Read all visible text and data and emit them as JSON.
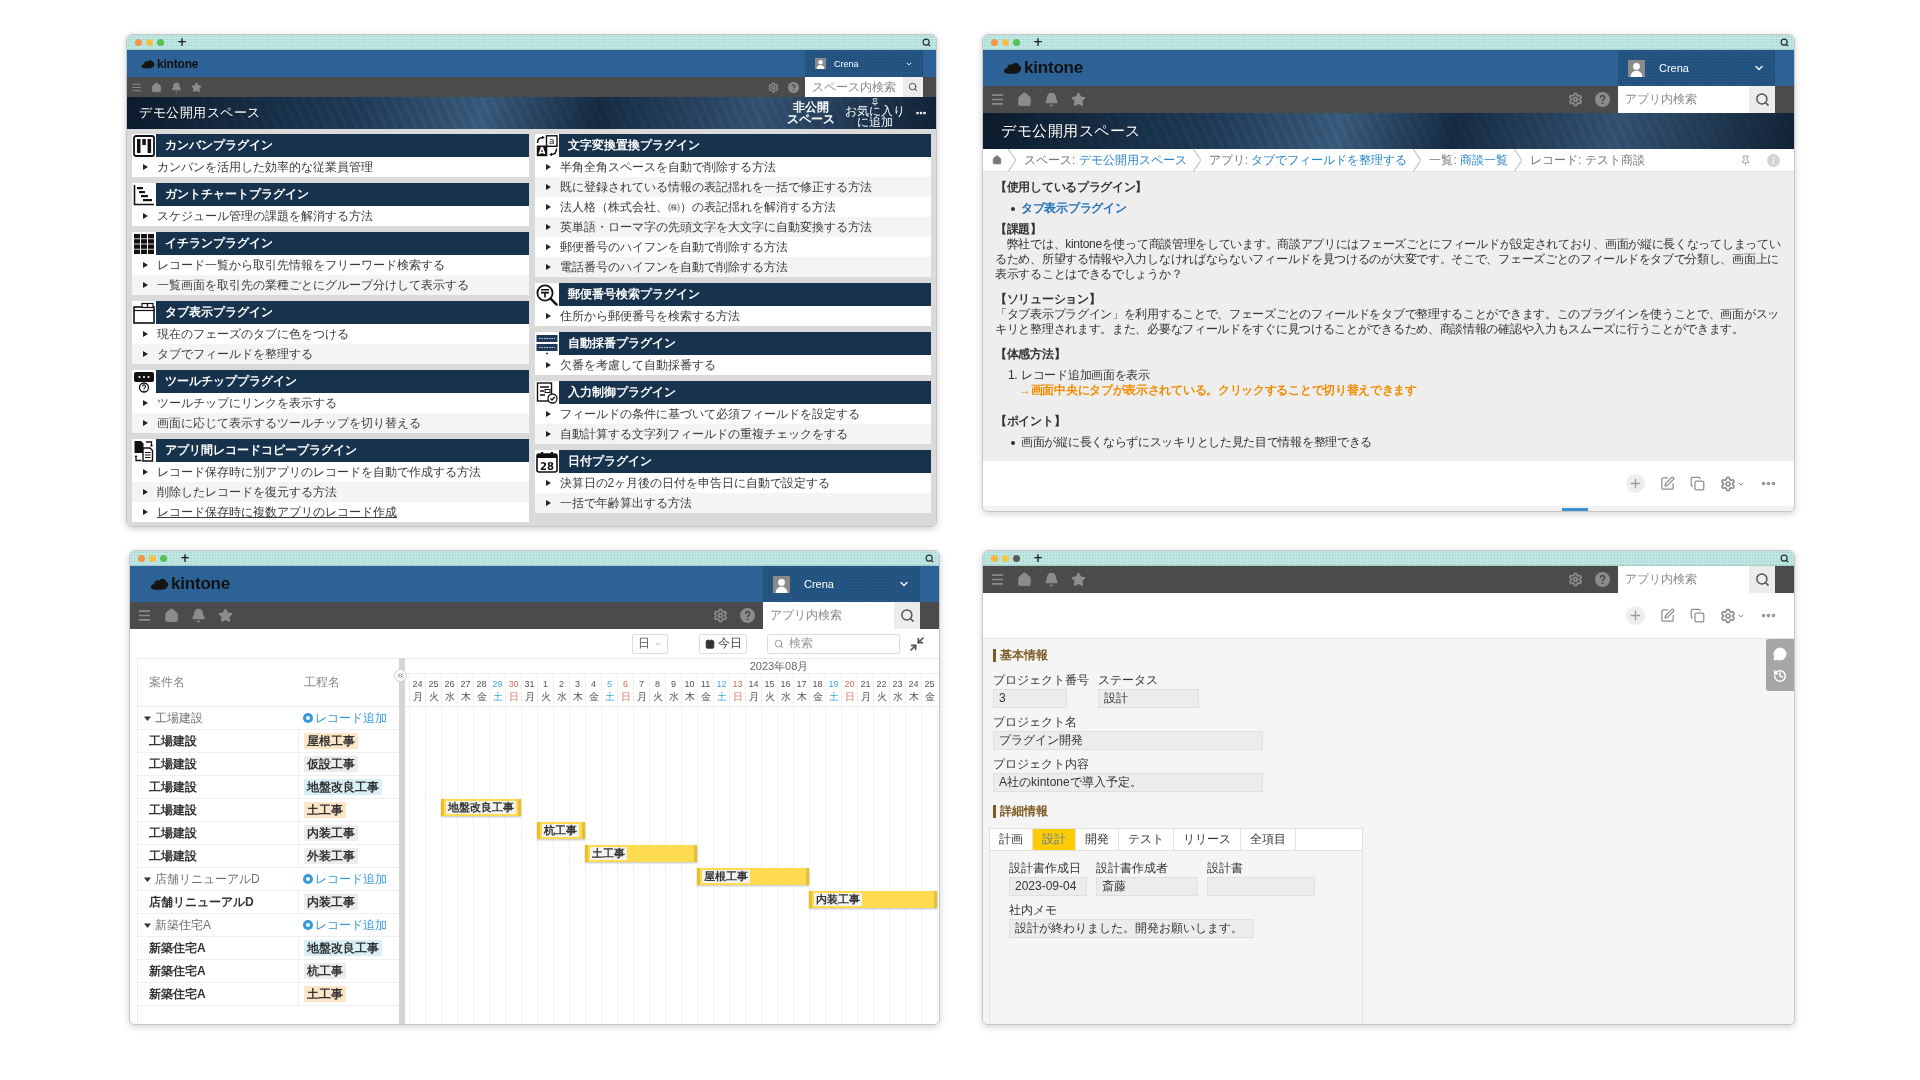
{
  "plugin_list_window": {
    "traffic_lights": [
      {
        "color": "#f0954a"
      },
      {
        "color": "#f5c04a"
      },
      {
        "color": "#56c14f"
      }
    ],
    "new_tab": "+",
    "logo": "kintone",
    "user": "Crena",
    "search": {
      "placeholder": "スペース内検索"
    },
    "banner": {
      "title": "デモ公開用スペース",
      "private_label": [
        "非公開",
        "スペース"
      ],
      "favorite_label": [
        "お気に入り",
        "に追加"
      ]
    },
    "columns": [
      {
        "sections": [
          {
            "title": "カンバンプラグイン",
            "kind": "kanban",
            "items": [
              {
                "text": "カンバンを活用した効率的な従業員管理",
                "underlined": false
              }
            ]
          },
          {
            "title": "ガントチャートプラグイン",
            "kind": "gantt",
            "items": [
              {
                "text": "スケジュール管理の課題を解消する方法",
                "underlined": false
              }
            ]
          },
          {
            "title": "イチランプラグイン",
            "kind": "grid",
            "items": [
              {
                "text": "レコード一覧から取引先情報をフリーワード検索する",
                "underlined": false
              },
              {
                "text": "一覧画面を取引先の業種ごとにグループ分けして表示する",
                "underlined": false
              }
            ]
          },
          {
            "title": "タブ表示プラグイン",
            "kind": "tab",
            "items": [
              {
                "text": "現在のフェーズのタブに色をつける",
                "underlined": false
              },
              {
                "text": "タブでフィールドを整理する",
                "underlined": false
              }
            ]
          },
          {
            "title": "ツールチッププラグイン",
            "kind": "tooltip",
            "items": [
              {
                "text": "ツールチップにリンクを表示する",
                "underlined": false
              },
              {
                "text": "画面に応じて表示するツールチップを切り替える",
                "underlined": false
              }
            ]
          },
          {
            "title": "アプリ間レコードコピープラグイン",
            "kind": "copy",
            "items": [
              {
                "text": "レコード保存時に別アプリのレコードを自動で作成する方法",
                "underlined": false
              },
              {
                "text": "削除したレコードを復元する方法",
                "underlined": false
              },
              {
                "text": "レコード保存時に複数アプリのレコード作成",
                "underlined": true
              }
            ]
          }
        ]
      },
      {
        "sections": [
          {
            "title": "文字変換置換プラグイン",
            "kind": "convert",
            "icon_text": [
              "a",
              "A"
            ],
            "items": [
              {
                "text": "半角全角スペースを自動で削除する方法",
                "underlined": false
              },
              {
                "text": "既に登録されている情報の表記揺れを一括で修正する方法",
                "underlined": false
              },
              {
                "text": "法人格（株式会社、㈱）の表記揺れを解消する方法",
                "underlined": false
              },
              {
                "text": "英単語・ローマ字の先頭文字を大文字に自動変換する方法",
                "underlined": false
              },
              {
                "text": "郵便番号のハイフンを自動で削除する方法",
                "underlined": false
              },
              {
                "text": "電話番号のハイフンを自動で削除する方法",
                "underlined": false
              }
            ]
          },
          {
            "title": "郵便番号検索プラグイン",
            "kind": "postal",
            "items": [
              {
                "text": "住所から郵便番号を検索する方法",
                "underlined": false
              }
            ]
          },
          {
            "title": "自動採番プラグイン",
            "kind": "numbering",
            "items": [
              {
                "text": "欠番を考慮して自動採番する",
                "underlined": false
              }
            ]
          },
          {
            "title": "入力制御プラグイン",
            "kind": "form",
            "items": [
              {
                "text": "フィールドの条件に基づいて必須フィールドを設定する",
                "underlined": false
              },
              {
                "text": "自動計算する文字列フィールドの重複チェックをする",
                "underlined": false
              }
            ]
          },
          {
            "title": "日付プラグイン",
            "kind": "calendar",
            "icon_text": [
              "28"
            ],
            "items": [
              {
                "text": "決算日の2ヶ月後の日付を申告日に自動で設定する",
                "underlined": false
              },
              {
                "text": "一括で年齢算出する方法",
                "underlined": false
              }
            ]
          }
        ]
      }
    ]
  },
  "record_detail_window": {
    "traffic_lights": [
      {
        "color": "#f0954a"
      },
      {
        "color": "#f5c04a"
      },
      {
        "color": "#56c14f"
      }
    ],
    "new_tab": "+",
    "logo": "kintone",
    "user": "Crena",
    "search": {
      "placeholder": "アプリ内検索"
    },
    "banner": {
      "title": "デモ公開用スペース"
    },
    "breadcrumbs": [
      {
        "label": "スペース:",
        "value": "デモ公開用スペース",
        "link": true
      },
      {
        "label": "アプリ:",
        "value": "タブでフィールドを整理する",
        "link": true
      },
      {
        "label": "一覧:",
        "value": "商談一覧",
        "link": true
      },
      {
        "label": "レコード:",
        "value": "テスト商談",
        "link": false
      }
    ],
    "content": [
      {
        "kind": "heading",
        "text": "【使用しているプラグイン】"
      },
      {
        "kind": "bullet",
        "text": "タブ表示プラグイン",
        "link": true
      },
      {
        "kind": "heading",
        "text": "【課題】"
      },
      {
        "kind": "paragraph",
        "text": "　弊社では、kintoneを使って商談管理をしています。商談アプリにはフェーズごとにフィールドが設定されており、画面が縦に長くなってしまっているため、所望する情報や入力しなければならないフィールドを見つけるのが大変です。そこで、フェーズごとのフィールドをタブで分類し、画面上に表示することはできるでしょうか？"
      },
      {
        "kind": "heading",
        "text": "【ソリューション】"
      },
      {
        "kind": "paragraph",
        "text": "「タブ表示プラグイン」を利用することで、フェーズごとのフィールドをタブで整理することができます。このプラグインを使うことで、画面がスッキリと整理されます。また、必要なフィールドをすぐに見つけることができるため、商談情報の確認や入力もスムーズに行うことができます。"
      },
      {
        "kind": "heading",
        "text": "【体感方法】"
      },
      {
        "kind": "numbered",
        "number": "1.",
        "text": "レコード追加画面を表示"
      },
      {
        "kind": "note",
        "text": "→画面中央にタブが表示されている。クリックすることで切り替えできます"
      },
      {
        "kind": "heading",
        "text": "【ポイント】"
      },
      {
        "kind": "bullet",
        "text": "画面が縦に長くならずにスッキリとした見た目で情報を整理できる",
        "link": false
      }
    ]
  },
  "gantt_window": {
    "traffic_lights": [
      {
        "color": "#f0954a"
      },
      {
        "color": "#f5c04a"
      },
      {
        "color": "#56c14f"
      }
    ],
    "new_tab": "+",
    "logo": "kintone",
    "user": "Crena",
    "search": {
      "placeholder": "アプリ内検索"
    },
    "toolbar": {
      "scale": "日",
      "today": "今日",
      "search_placeholder": "検索"
    },
    "list_columns": [
      "案件名",
      "工程名"
    ],
    "months": [
      {
        "days": [
          {
            "day": "24",
            "weekday": "月",
            "kind": "weekday"
          },
          {
            "day": "25",
            "weekday": "火",
            "kind": "weekday"
          },
          {
            "day": "26",
            "weekday": "水",
            "kind": "weekday"
          },
          {
            "day": "27",
            "weekday": "木",
            "kind": "weekday"
          },
          {
            "day": "28",
            "weekday": "金",
            "kind": "weekday"
          },
          {
            "day": "29",
            "weekday": "土",
            "kind": "saturday"
          },
          {
            "day": "30",
            "weekday": "日",
            "kind": "sunday"
          },
          {
            "day": "31",
            "weekday": "月",
            "kind": "weekday"
          }
        ]
      },
      {
        "label": "2023年08月",
        "days": [
          {
            "day": "1",
            "weekday": "火",
            "kind": "weekday"
          },
          {
            "day": "2",
            "weekday": "水",
            "kind": "weekday"
          },
          {
            "day": "3",
            "weekday": "木",
            "kind": "weekday"
          },
          {
            "day": "4",
            "weekday": "金",
            "kind": "weekday"
          },
          {
            "day": "5",
            "weekday": "土",
            "kind": "saturday"
          },
          {
            "day": "6",
            "weekday": "日",
            "kind": "sunday"
          },
          {
            "day": "7",
            "weekday": "月",
            "kind": "weekday"
          },
          {
            "day": "8",
            "weekday": "火",
            "kind": "weekday"
          },
          {
            "day": "9",
            "weekday": "水",
            "kind": "weekday"
          },
          {
            "day": "10",
            "weekday": "木",
            "kind": "weekday"
          },
          {
            "day": "11",
            "weekday": "金",
            "kind": "weekday"
          },
          {
            "day": "12",
            "weekday": "土",
            "kind": "saturday"
          },
          {
            "day": "13",
            "weekday": "日",
            "kind": "sunday"
          },
          {
            "day": "14",
            "weekday": "月",
            "kind": "weekday"
          },
          {
            "day": "15",
            "weekday": "火",
            "kind": "weekday"
          },
          {
            "day": "16",
            "weekday": "水",
            "kind": "weekday"
          },
          {
            "day": "17",
            "weekday": "木",
            "kind": "weekday"
          },
          {
            "day": "18",
            "weekday": "金",
            "kind": "weekday"
          },
          {
            "day": "19",
            "weekday": "土",
            "kind": "saturday"
          },
          {
            "day": "20",
            "weekday": "日",
            "kind": "sunday"
          },
          {
            "day": "21",
            "weekday": "月",
            "kind": "weekday"
          },
          {
            "day": "22",
            "weekday": "火",
            "kind": "weekday"
          },
          {
            "day": "23",
            "weekday": "水",
            "kind": "weekday"
          },
          {
            "day": "24",
            "weekday": "木",
            "kind": "weekday"
          },
          {
            "day": "25",
            "weekday": "金",
            "kind": "weekday"
          }
        ]
      }
    ],
    "groups": [
      {
        "name": "工場建設",
        "expanded": true,
        "add_label": "レコード追加",
        "rows": [
          {
            "name": "工場建設",
            "process": "屋根工事",
            "color": "#fbe6c8"
          },
          {
            "name": "工場建設",
            "process": "仮設工事",
            "color": "#ececec"
          },
          {
            "name": "工場建設",
            "process": "地盤改良工事",
            "color": "#d8eff6"
          },
          {
            "name": "工場建設",
            "process": "土工事",
            "color": "#fbe6c8",
            "bar": {
              "label": "地盤改良工事",
              "start": {
                "level": 0.0606
              },
              "end": {
                "level": 0.2121
              }
            }
          },
          {
            "name": "工場建設",
            "process": "内装工事",
            "color": "#ececec",
            "bar": {
              "label": "杭工事",
              "start": {
                "level": 0.2424
              },
              "end": {
                "level": 0.3333
              }
            }
          },
          {
            "name": "工場建設",
            "process": "外装工事",
            "color": "#ececec",
            "bar": {
              "label": "土工事",
              "start": {
                "level": 0.3333
              },
              "end": {
                "level": 0.5455
              }
            }
          }
        ]
      },
      {
        "name": "店舗リニューアルD",
        "expanded": true,
        "add_label": "レコード追加",
        "bar": {
          "label": "屋根工事",
          "start": {
            "level": 0.5455
          },
          "end": {
            "level": 0.7576
          }
        },
        "rows": [
          {
            "name": "店舗リニューアルD",
            "process": "内装工事",
            "color": "#ececec",
            "bar": {
              "label": "内装工事",
              "start": {
                "level": 0.7576
              },
              "end": {
                "level": 1
              }
            }
          }
        ]
      },
      {
        "name": "新築住宅A",
        "expanded": true,
        "add_label": "レコード追加",
        "rows": [
          {
            "name": "新築住宅A",
            "process": "地盤改良工事",
            "color": "#d8eff6"
          },
          {
            "name": "新築住宅A",
            "process": "杭工事",
            "color": "#ececec"
          },
          {
            "name": "新築住宅A",
            "process": "土工事",
            "color": "#fbe6c8"
          }
        ]
      }
    ]
  },
  "record_form_window": {
    "traffic_lights": [
      {
        "color": "#f4b63f"
      },
      {
        "color": "#f2c84b"
      },
      {
        "color": "#5a5a5a"
      }
    ],
    "new_tab": "+",
    "search": {
      "placeholder": "アプリ内検索"
    },
    "sections": [
      {
        "title": "基本情報",
        "field_rows": [
          [
            {
              "label": "プロジェクト番号",
              "value": "3",
              "kind": "number"
            },
            {
              "label": "ステータス",
              "value": "設計",
              "kind": "status"
            }
          ],
          [
            {
              "label": "プロジェクト名",
              "value": "プラグイン開発",
              "kind": "text"
            }
          ],
          [
            {
              "label": "プロジェクト内容",
              "value": "A社のkintoneで導入予定。",
              "kind": "text"
            }
          ]
        ]
      },
      {
        "title": "詳細情報",
        "tabs": [
          {
            "label": "計画",
            "selected": false
          },
          {
            "label": "設計",
            "selected": true
          },
          {
            "label": "開発",
            "selected": false
          },
          {
            "label": "テスト",
            "selected": false
          },
          {
            "label": "リリース",
            "selected": false
          },
          {
            "label": "全項目",
            "selected": false
          }
        ],
        "field_rows": [
          [
            {
              "label": "設計書作成日",
              "value": "2023-09-04",
              "kind": "date"
            },
            {
              "label": "設計書作成者",
              "value": "斎藤",
              "kind": "user"
            },
            {
              "label": "設計書",
              "kind": "file"
            }
          ],
          [
            {
              "label": "社内メモ",
              "value": "設計が終わりました。開発お願いします。",
              "kind": "memo"
            }
          ]
        ]
      }
    ]
  }
}
